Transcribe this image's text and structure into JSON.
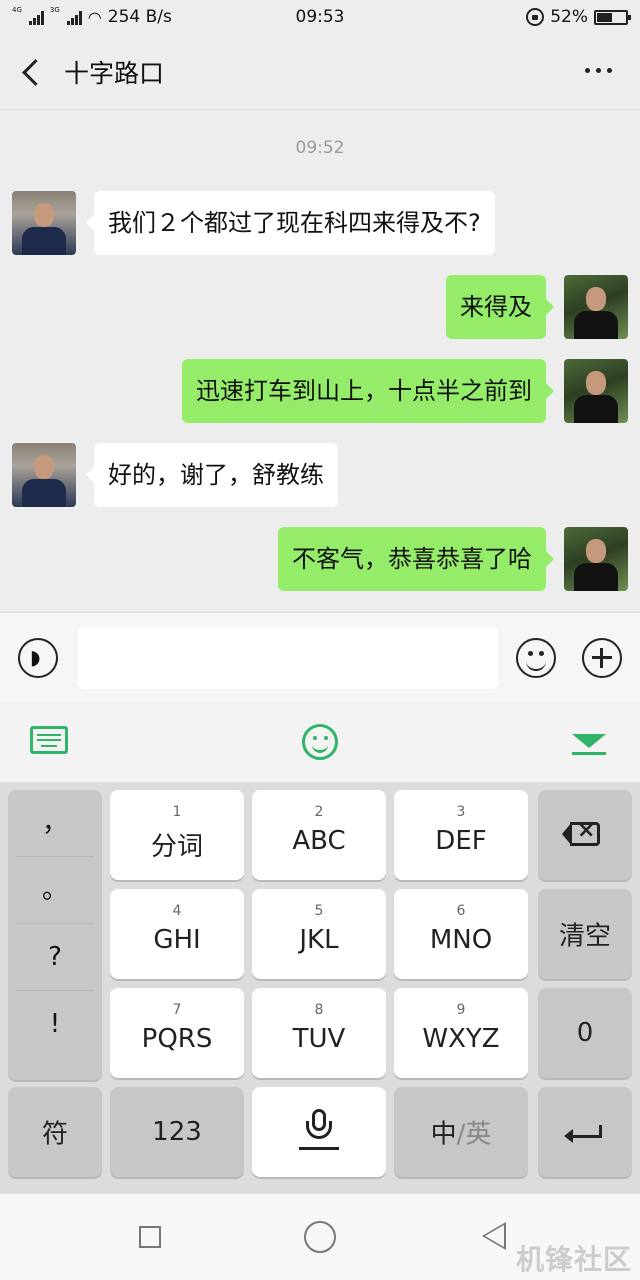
{
  "status_bar": {
    "net1": "4G",
    "net2": "3G",
    "speed": "254 B/s",
    "clock": "09:53",
    "battery_pct": "52%",
    "battery_level": 0.52
  },
  "header": {
    "title": "十字路口"
  },
  "chat": {
    "timestamp": "09:52",
    "messages": [
      {
        "side": "left",
        "text": "我们２个都过了现在科四来得及不?"
      },
      {
        "side": "right",
        "text": "来得及"
      },
      {
        "side": "right",
        "text": "迅速打车到山上，十点半之前到"
      },
      {
        "side": "left",
        "text": "好的，谢了，舒教练"
      },
      {
        "side": "right",
        "text": "不客气，恭喜恭喜了哈"
      }
    ]
  },
  "keyboard": {
    "punct": [
      "，",
      "。",
      "?",
      "!"
    ],
    "keys": [
      {
        "num": "1",
        "label": "分词"
      },
      {
        "num": "2",
        "label": "ABC"
      },
      {
        "num": "3",
        "label": "DEF"
      },
      {
        "num": "4",
        "label": "GHI"
      },
      {
        "num": "5",
        "label": "JKL"
      },
      {
        "num": "6",
        "label": "MNO"
      },
      {
        "num": "7",
        "label": "PQRS"
      },
      {
        "num": "8",
        "label": "TUV"
      },
      {
        "num": "9",
        "label": "WXYZ"
      }
    ],
    "clear": "清空",
    "zero": "0",
    "symbols": "符",
    "numbers": "123",
    "lang_zh": "中",
    "lang_sep": "/",
    "lang_en": "英"
  },
  "colors": {
    "sent_bubble": "#95ec69",
    "received_bubble": "#ffffff",
    "accent": "#2fb46a"
  },
  "watermark": "机锋社区"
}
